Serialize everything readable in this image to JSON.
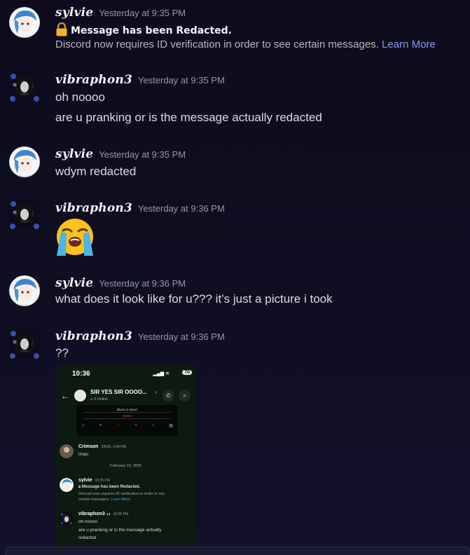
{
  "messages": [
    {
      "author": "sylvie",
      "timestamp": "Yesterday at 9:35 PM",
      "system_title": "Message has been Redacted.",
      "system_body": "Discord now requires ID verification in order to see certain messages.",
      "system_link": "Learn More"
    },
    {
      "author": "vibraphon3",
      "timestamp": "Yesterday at 9:35 PM",
      "lines": [
        "oh noooo",
        "are u pranking or is the message actually redacted"
      ]
    },
    {
      "author": "sylvie",
      "timestamp": "Yesterday at 9:35 PM",
      "lines": [
        "wdym redacted"
      ]
    },
    {
      "author": "vibraphon3",
      "timestamp": "Yesterday at 9:36 PM",
      "emoji": "loudly-crying-face"
    },
    {
      "author": "sylvie",
      "timestamp": "Yesterday at 9:36 PM",
      "lines": [
        "what does it look like for u??? it’s just a picture i took"
      ]
    },
    {
      "author": "vibraphon3",
      "timestamp": "Yesterday at 9:36 PM",
      "lines": [
        "??"
      ]
    }
  ],
  "screenshot": {
    "time": "10:36",
    "battery": "70",
    "group_name": "SIR YES SIR OOOO...",
    "online": "3 Online",
    "card_line1": "Block or report",
    "card_line2": "Delete",
    "crimson_name": "Crimson",
    "crimson_ts": "2/8/26, 3:49 PM",
    "crimson_text": "lmao",
    "divider": "February 10, 2026",
    "sylvie_name": "sylvie",
    "sylvie_ts": "10:35 PM",
    "sylvie_title": "Message has been Redacted.",
    "sylvie_body1": "Discord now requires ID verification in order to see",
    "sylvie_body2": "certain messages.",
    "sylvie_link": "Learn More",
    "vib_name": "vibraphon3",
    "vib_ts": "10:35 PM",
    "vib_line1": "oh noooo",
    "vib_line2": "are u pranking or is the message actually",
    "vib_line3": "redacted"
  },
  "colors": {
    "background": "#100e22",
    "link": "#7e9cf0",
    "timestamp": "#949ba4"
  }
}
